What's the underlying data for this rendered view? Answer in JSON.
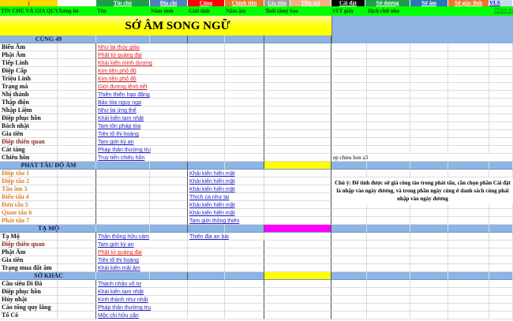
{
  "top_cell": "1",
  "tabs": [
    {
      "label": "Tín chủ",
      "bg": "#1f9e4a"
    },
    {
      "label": "Địa chỉ",
      "bg": "#4f81bd"
    },
    {
      "label": "Cúng",
      "bg": "#ff0000"
    },
    {
      "label": "Chính tiên",
      "bg": "#e87a2a"
    },
    {
      "label": "Gia tiên",
      "bg": "#9a9a9a"
    },
    {
      "label": "Tiền mã",
      "bg": "#f4b183"
    },
    {
      "label": "Cài đặt",
      "bg": "#000000"
    },
    {
      "label": "Sớ dương",
      "bg": "#1f9e4a"
    },
    {
      "label": "Sớ âm",
      "bg": "#2e75b6"
    },
    {
      "label": "Sớ giác linh",
      "bg": "#e87a2a"
    },
    {
      "label": "VLS",
      "bg": "#c6d9f1"
    }
  ],
  "headers": [
    "TÍN CHỦ VÀ GIA QUYẾN",
    "Xưng hô",
    "Tên",
    "Năm sinh",
    "Giới tính",
    "Năm âm",
    "Tuổi (âm) Sao",
    "STT giấy",
    "Dịch chữ nho",
    "Chọn in"
  ],
  "title": "SỚ ÂM SONG NGỮ",
  "note_cell": "ep chieu hon a3",
  "note": "Chú ý: Để tính được sứ giả công tào trong phát tấu, cần chọn phần Cài đặt là nhập vào ngày dương, và trong phần ngày cúng ở danh sách cúng phải nhập vào ngày dương",
  "sections": [
    {
      "title": "CÚNG 49",
      "marker": "",
      "rows": [
        {
          "label": "Biểu Âm",
          "c": "Như lai thùy giáo",
          "c_red": true
        },
        {
          "label": "Phật Âm",
          "c": "Phật tử quảng đại",
          "c_red": true
        },
        {
          "label": "Tiếp Linh",
          "c": "Khải kiến minh dương",
          "c_red": true
        },
        {
          "label": "Điệp Cấp",
          "c": "Kim tiền phổ độ",
          "c_red": true
        },
        {
          "label": "Triệu Linh",
          "c": "Kim tiền phổ độ",
          "c_red": true
        },
        {
          "label": "Trạng mà",
          "c": "Giới đương lệnh tiết",
          "c_red": true
        },
        {
          "label": "Nhị thánh",
          "c": "Thiên thiên hạo đãng"
        },
        {
          "label": "Thập điện",
          "c": "Bảo tòa nguy nga"
        },
        {
          "label": "Nhập Liệm",
          "c": "Như lai ứng thế"
        },
        {
          "label": "Điệp phục hồn",
          "c": "Khải kiến tam nhật"
        },
        {
          "label": "Bách nhật",
          "c": "Tam tôn pháp tòa"
        },
        {
          "label": "Gia tiên",
          "c": "Tiên tổ thi hoàng"
        },
        {
          "label": "Điệp thiên quan",
          "c": "Tam giới kỳ an",
          "brown": true
        },
        {
          "label": "Cát táng",
          "c": "Pháp thân thường trụ"
        },
        {
          "label": "Chiêu hồn",
          "c": "Truy tiến chiêu hồn",
          "note": true
        }
      ]
    },
    {
      "title": "PHÁT TẤU ĐỘ ÂM",
      "marker": "#ffff00",
      "rows": [
        {
          "label": "Điệp tấu 1",
          "d": "Khải kiến hiển mặt",
          "orange": true
        },
        {
          "label": "Điệp tấu 2",
          "d": "Khải kiến hiển mặt",
          "orange": true
        },
        {
          "label": "Tấu âm 3",
          "d": "Khải kiến hiển mặt",
          "orange": true
        },
        {
          "label": "Biểu tấu 4",
          "d": "Thích ca như lai",
          "orange": true
        },
        {
          "label": "Đơn tấu 5",
          "d": "Khải kiến hiển mặt",
          "orange": true
        },
        {
          "label": "Quan tấu 6",
          "d": "Khải kiến hiển mặt",
          "orange": true
        },
        {
          "label": "Phát tấu 7",
          "d": "Tam giới thông thiên",
          "orange": true
        }
      ]
    },
    {
      "title": "TẠ MỘ",
      "marker": "#ff00ff",
      "rows": [
        {
          "label": "Tạ Mộ",
          "c": "Thần thông hữu cảm",
          "d": "Thiên địa an bài"
        },
        {
          "label": "Điệp thiên quan",
          "c": "Tam giới kỳ an",
          "brown": true
        },
        {
          "label": "Phật Âm",
          "c": "Phật tử quảng đại",
          "c_red": true
        },
        {
          "label": "Gia tiên",
          "c": "Tiên tổ thi hoàng"
        },
        {
          "label": "Trạng mua đất âm",
          "c": "Khải kiến mãi âm"
        }
      ]
    },
    {
      "title": "SỚ KHÁC",
      "marker": "#ffff00",
      "rows": [
        {
          "label": "Cầu siêu Di Đà",
          "c": "Thành nhân vô tư"
        },
        {
          "label": "Điệp phục hồn",
          "c": "Khải kiến tam nhật"
        },
        {
          "label": "Hủy nhật",
          "c": "Kinh thành như nhất"
        },
        {
          "label": "Cáo tổng quy lăng",
          "c": "Pháp thân thường trụ"
        },
        {
          "label": "Tổ Cô",
          "c": "Mộc chi hữu căn"
        }
      ]
    }
  ]
}
